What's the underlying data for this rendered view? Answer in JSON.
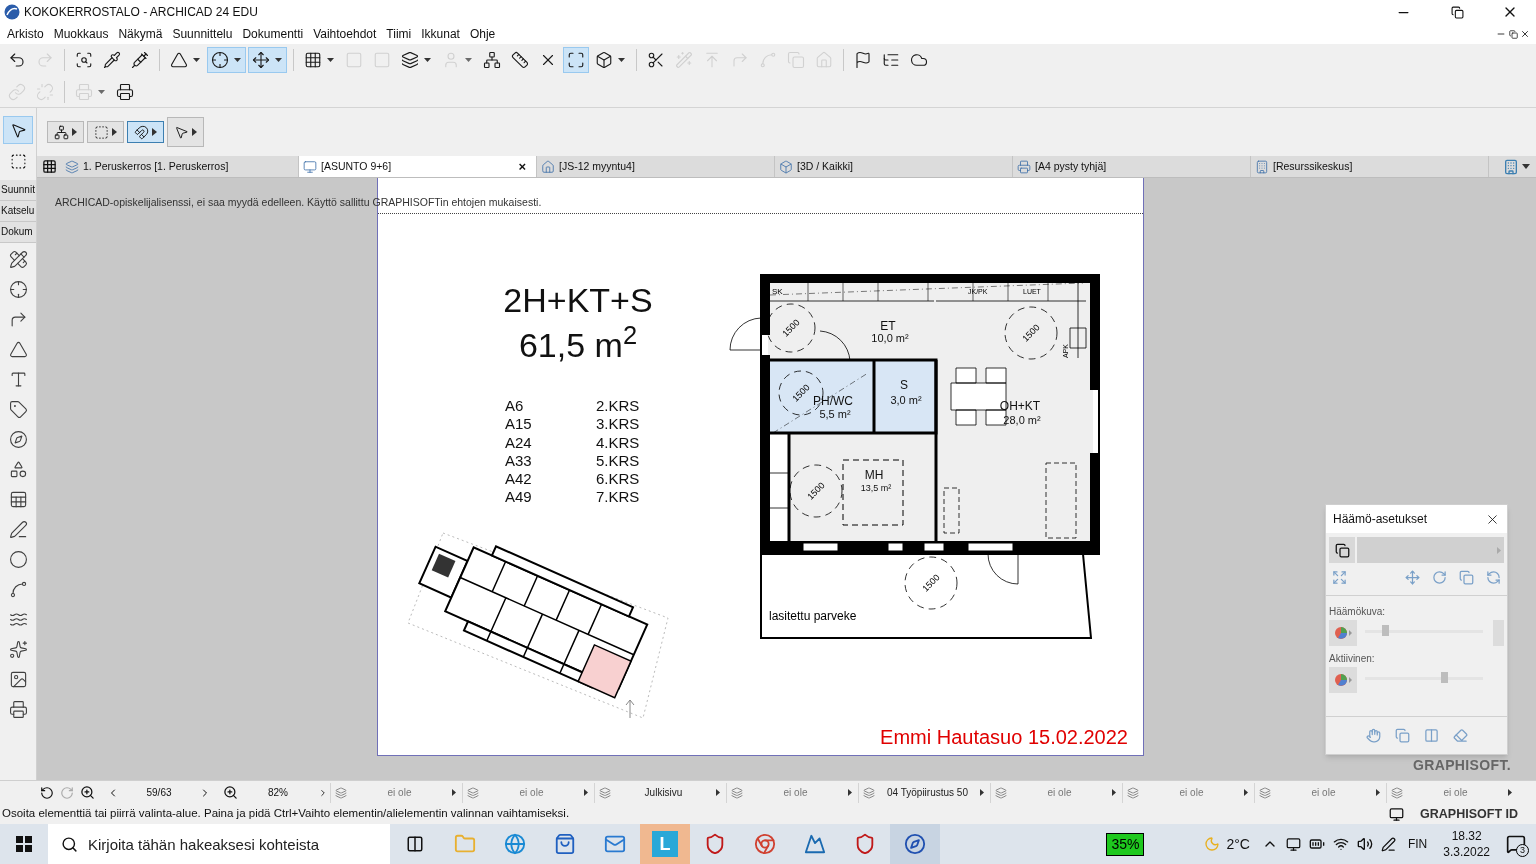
{
  "window": {
    "title": "KOKOKERROSTALO - ARCHICAD 24 EDU"
  },
  "menu": [
    "Arkisto",
    "Muokkaus",
    "Näkymä",
    "Suunnittelu",
    "Dokumentti",
    "Vaihtoehdot",
    "Tiimi",
    "Ikkunat",
    "Ohje"
  ],
  "toolbar_1": [
    {
      "kind": "button",
      "selected": false,
      "disabled": false
    },
    {
      "kind": "button",
      "selected": false,
      "disabled": true
    },
    {
      "kind": "separator"
    },
    {
      "kind": "button",
      "selected": false,
      "disabled": false
    },
    {
      "kind": "button",
      "selected": false,
      "disabled": false
    },
    {
      "kind": "button",
      "selected": false,
      "disabled": false
    },
    {
      "kind": "separator"
    },
    {
      "kind": "dropdown",
      "selected": false,
      "disabled": false
    },
    {
      "kind": "dropdown",
      "selected": true,
      "disabled": false
    },
    {
      "kind": "dropdown",
      "selected": true,
      "disabled": false
    },
    {
      "kind": "separator"
    },
    {
      "kind": "dropdown",
      "selected": false,
      "disabled": false
    },
    {
      "kind": "button",
      "selected": false,
      "disabled": true
    },
    {
      "kind": "button",
      "selected": false,
      "disabled": true
    },
    {
      "kind": "dropdown",
      "selected": false,
      "disabled": false
    },
    {
      "kind": "dropdown",
      "selected": false,
      "disabled": true
    },
    {
      "kind": "button",
      "selected": false,
      "disabled": false
    },
    {
      "kind": "button",
      "selected": false,
      "disabled": false
    },
    {
      "kind": "button",
      "selected": false,
      "disabled": false
    },
    {
      "kind": "button",
      "selected": true,
      "disabled": false
    },
    {
      "kind": "dropdown",
      "selected": false,
      "disabled": false
    },
    {
      "kind": "separator"
    },
    {
      "kind": "button",
      "selected": false,
      "disabled": false
    },
    {
      "kind": "button",
      "selected": false,
      "disabled": true
    },
    {
      "kind": "button",
      "selected": false,
      "disabled": true
    },
    {
      "kind": "button",
      "selected": false,
      "disabled": true
    },
    {
      "kind": "button",
      "selected": false,
      "disabled": true
    },
    {
      "kind": "button",
      "selected": false,
      "disabled": true
    },
    {
      "kind": "button",
      "selected": false,
      "disabled": true
    },
    {
      "kind": "separator"
    },
    {
      "kind": "button",
      "selected": false,
      "disabled": false
    },
    {
      "kind": "button",
      "selected": false,
      "disabled": false
    },
    {
      "kind": "button",
      "selected": false,
      "disabled": false
    }
  ],
  "toolbar_2": [
    {
      "kind": "button",
      "selected": false,
      "disabled": true
    },
    {
      "kind": "button",
      "selected": false,
      "disabled": true
    },
    {
      "kind": "separator"
    },
    {
      "kind": "dropdown",
      "selected": false,
      "disabled": true
    },
    {
      "kind": "button",
      "selected": false,
      "disabled": false
    }
  ],
  "info_box": [
    {
      "selected": false
    },
    {
      "selected": false
    },
    {
      "selected": true
    },
    {
      "selected": false
    }
  ],
  "toolbox": {
    "tabs": [
      "Suunnit",
      "Katselu",
      "Dokum"
    ],
    "selection_tools": [
      {
        "selected": true
      },
      {
        "selected": false
      }
    ]
  },
  "tabs": [
    {
      "label": "1. Peruskerros [1. Peruskerros]",
      "selected": false
    },
    {
      "label": "[ASUNTO 9+6]",
      "selected": true,
      "close": "×"
    },
    {
      "label": "[JS-12 myyntu4]",
      "selected": false
    },
    {
      "label": "[3D / Kaikki]",
      "selected": false
    },
    {
      "label": "[A4 pysty tyhjä]",
      "selected": false
    },
    {
      "label": "[Resurssikeskus]",
      "selected": false
    }
  ],
  "license_notice": "ARCHICAD-opiskelijalisenssi, ei saa myydä edelleen. Käyttö sallittu GRAPHISOFTin ehtojen mukaisesti.",
  "sheet": {
    "apartment_type": "2H+KT+S",
    "area": "61,5 m$^{2}$",
    "apartments": [
      {
        "code": "A6",
        "floor": "2.KRS"
      },
      {
        "code": "A15",
        "floor": "3.KRS"
      },
      {
        "code": "A24",
        "floor": "4.KRS"
      },
      {
        "code": "A33",
        "floor": "5.KRS"
      },
      {
        "code": "A42",
        "floor": "6.KRS"
      },
      {
        "code": "A49",
        "floor": "7.KRS"
      }
    ],
    "plan_labels": {
      "closet": "SK",
      "fridge": "JK/PK",
      "stove": "LUET",
      "dishwasher": "APK",
      "turning_circles": [
        "1500",
        "1500",
        "1500",
        "1500",
        "1500"
      ]
    },
    "rooms": [
      {
        "name": "ET",
        "area": "10,0 m²"
      },
      {
        "name": "PH/WC",
        "area": "5,5 m²"
      },
      {
        "name": "S",
        "area": "3,0 m²"
      },
      {
        "name": "OH+KT",
        "area": "28,0 m²"
      },
      {
        "name": "MH",
        "area": "13,5 m²"
      },
      {
        "name": "lasitettu parveke"
      }
    ],
    "signature": "Emmi Hautasuo 15.02.2022"
  },
  "canvas_logo": "GRAPHISOFT.",
  "palette": {
    "title": "Häämö-asetukset",
    "ghost": {
      "label": "Häämökuva:",
      "level": 0.17
    },
    "active": {
      "label": "Aktiivinen:",
      "level": 0.67
    }
  },
  "quick_options": {
    "page": "59/63",
    "zoom": "82%",
    "fields": [
      "ei ole",
      "ei ole",
      "Julkisivu",
      "ei ole",
      "04 Työpiirustus 50",
      "ei ole",
      "ei ole",
      "ei ole",
      "ei ole"
    ]
  },
  "status_bar": {
    "message": "Osoita elementtiä tai piirrä valinta-alue. Paina ja pidä Ctrl+Vaihto elementin/alielementin valinnan vaihtamiseksi.",
    "id_button": "GRAPHISOFT ID"
  },
  "taskbar": {
    "search_placeholder": "Kirjoita tähän hakeaksesi kohteista",
    "app_letter": "L",
    "battery": "35%",
    "temperature": "2°C",
    "language": "FIN",
    "time": "18.32",
    "date": "3.3.2022",
    "notifications": "3"
  }
}
